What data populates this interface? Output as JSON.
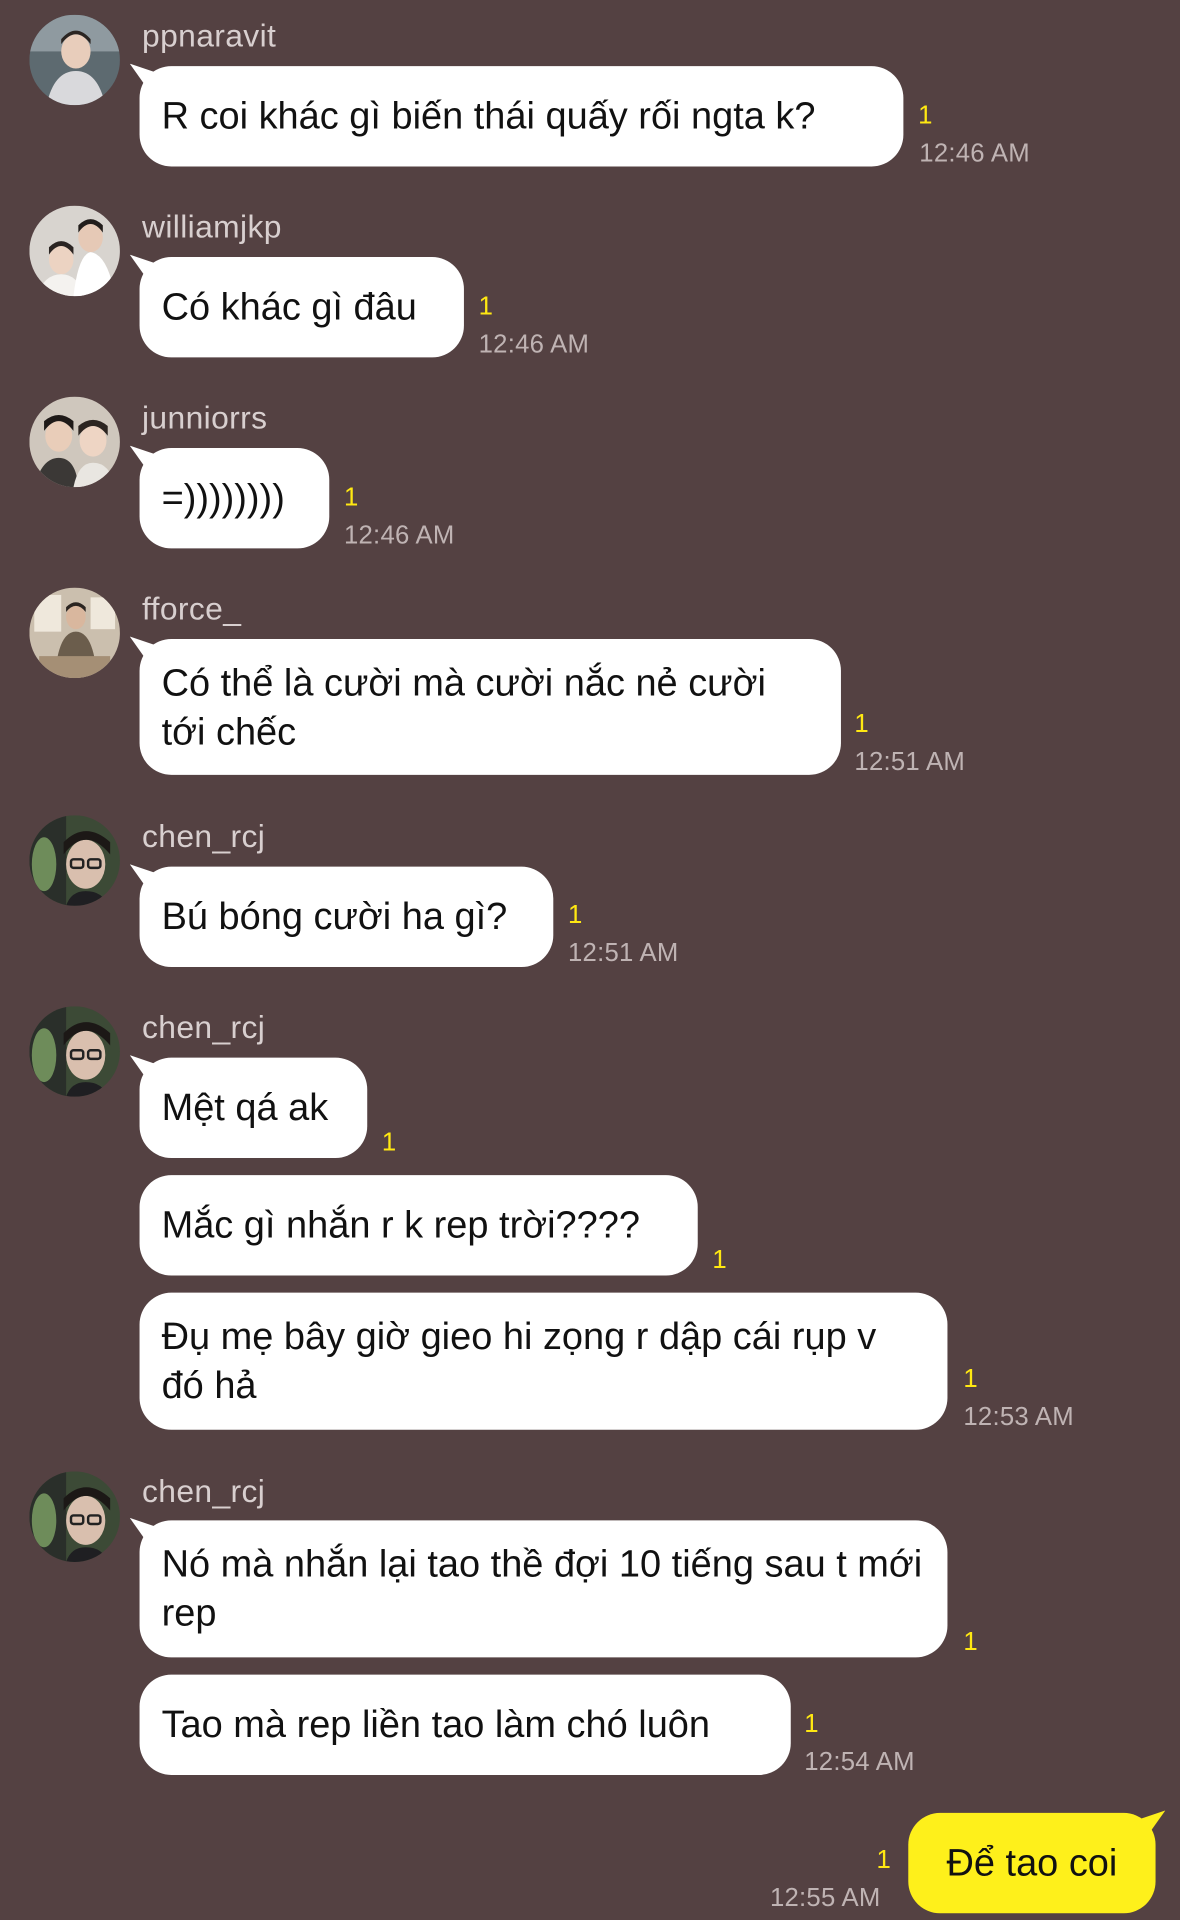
{
  "colors": {
    "background": "#544142",
    "bubble_incoming": "#ffffff",
    "bubble_outgoing": "#fef01b",
    "unread_count": "#ffe812",
    "timestamp": "#bfb3b3",
    "sender_name": "#d8cfcf"
  },
  "messages": [
    {
      "sender": "ppnaravit",
      "text": "R coi khác gì biến thái quấy rối ngta k?",
      "unread": "1",
      "time": "12:46 AM"
    },
    {
      "sender": "williamjkp",
      "text": "Có khác gì đâu",
      "unread": "1",
      "time": "12:46 AM"
    },
    {
      "sender": "junniorrs",
      "text": "=))))))))",
      "unread": "1",
      "time": "12:46 AM"
    },
    {
      "sender": "fforce_",
      "text": "Có thể là cười mà cười nắc nẻ cười tới chếc",
      "unread": "1",
      "time": "12:51 AM"
    },
    {
      "sender": "chen_rcj",
      "text": "Bú bóng cười ha gì?",
      "unread": "1",
      "time": "12:51 AM"
    },
    {
      "sender": "chen_rcj",
      "text": "Mệt qá ak",
      "unread": "1",
      "time": ""
    },
    {
      "sender": "",
      "text": "Mắc gì nhắn r k rep trời????",
      "unread": "1",
      "time": ""
    },
    {
      "sender": "",
      "text": "Đụ mẹ bây giờ gieo hi zọng r dập cái rụp v đó hả",
      "unread": "1",
      "time": "12:53 AM"
    },
    {
      "sender": "chen_rcj",
      "text": "Nó mà nhắn lại tao thề đợi 10 tiếng sau t mới rep",
      "unread": "1",
      "time": ""
    },
    {
      "sender": "",
      "text": "Tao mà rep liền tao làm chó luôn",
      "unread": "1",
      "time": "12:54 AM"
    },
    {
      "sender": "me",
      "text": "Để tao coi",
      "unread": "1",
      "time": "12:55 AM"
    }
  ]
}
